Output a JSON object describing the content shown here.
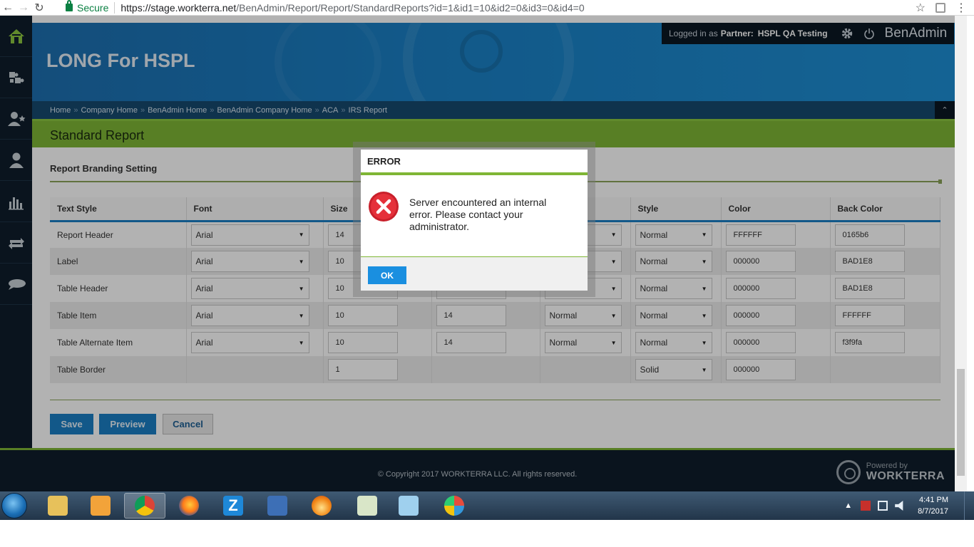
{
  "browser": {
    "secure_label": "Secure",
    "url_host": "https://stage.workterra.net",
    "url_path": "/BenAdmin/Report/Report/StandardReports?id=1&id1=10&id2=0&id3=0&id4=0"
  },
  "header": {
    "app_title": "LONG For HSPL",
    "logged_in_prefix": "Logged in as",
    "partner_label": "Partner:",
    "partner_name": "HSPL QA Testing",
    "brand": "BenAdmin"
  },
  "breadcrumb": [
    "Home",
    "Company Home",
    "BenAdmin Home",
    "BenAdmin Company Home",
    "ACA",
    "IRS Report"
  ],
  "page_title": "Standard Report",
  "section_title": "Report Branding Setting",
  "table": {
    "headers": [
      "Text Style",
      "Font",
      "Size",
      "",
      "",
      "Style",
      "Color",
      "Back Color"
    ],
    "rows": [
      {
        "label": "Report Header",
        "font": "Arial",
        "size": "14",
        "lineheight": "",
        "weight": "",
        "style": "Normal",
        "color": "FFFFFF",
        "back": "0165b6"
      },
      {
        "label": "Label",
        "font": "Arial",
        "size": "10",
        "lineheight": "",
        "weight": "",
        "style": "Normal",
        "color": "000000",
        "back": "BAD1E8"
      },
      {
        "label": "Table Header",
        "font": "Arial",
        "size": "10",
        "lineheight": "",
        "weight": "",
        "style": "Normal",
        "color": "000000",
        "back": "BAD1E8"
      },
      {
        "label": "Table Item",
        "font": "Arial",
        "size": "10",
        "lineheight": "14",
        "weight": "Normal",
        "style": "Normal",
        "color": "000000",
        "back": "FFFFFF"
      },
      {
        "label": "Table Alternate Item",
        "font": "Arial",
        "size": "10",
        "lineheight": "14",
        "weight": "Normal",
        "style": "Normal",
        "color": "000000",
        "back": "f3f9fa"
      },
      {
        "label": "Table Border",
        "size": "1",
        "style": "Solid",
        "color": "000000"
      }
    ]
  },
  "buttons": {
    "save": "Save",
    "preview": "Preview",
    "cancel": "Cancel"
  },
  "dialog": {
    "title": "ERROR",
    "message": "Server encountered an internal error. Please contact your administrator.",
    "ok": "OK"
  },
  "footer": {
    "copyright": "© Copyright 2017 WORKTERRA LLC. All rights reserved.",
    "powered_by": "Powered by",
    "logo_text": "WORKTERRA"
  },
  "taskbar": {
    "time": "4:41 PM",
    "date": "8/7/2017"
  },
  "colors": {
    "accent_blue": "#1a7fc4",
    "accent_green": "#7fb635",
    "nav_dark": "#0f1e2c"
  },
  "icons": {
    "left_nav": [
      "home-icon",
      "puzzle-icon",
      "user-star-icon",
      "user-icon",
      "bar-chart-icon",
      "transfer-icon",
      "chat-bubble-icon"
    ],
    "taskbar_apps": [
      "file-explorer-icon",
      "media-player-icon",
      "chrome-icon",
      "firefox-icon",
      "z-app-icon",
      "remote-desktop-icon",
      "flame-app-icon",
      "spreadsheet-icon",
      "notepad-icon",
      "paint-icon"
    ]
  }
}
